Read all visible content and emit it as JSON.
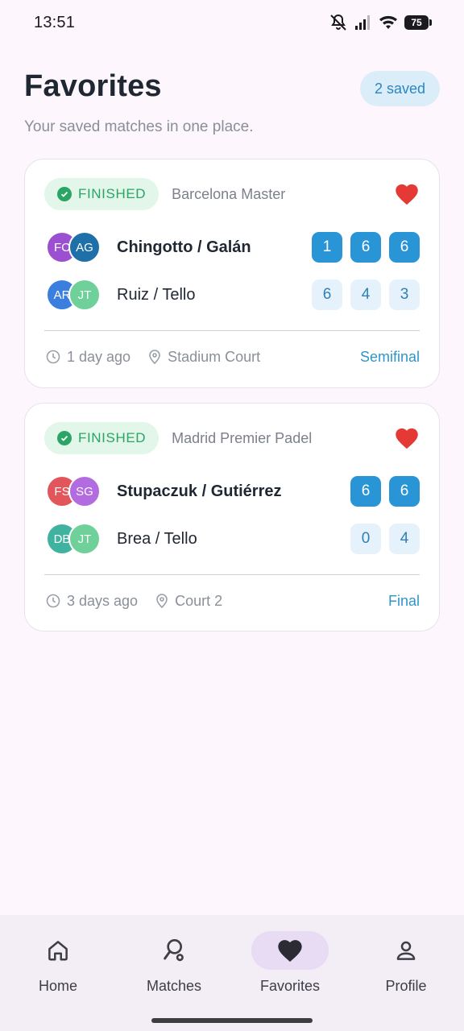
{
  "status_bar": {
    "time": "13:51",
    "battery": "75"
  },
  "header": {
    "title": "Favorites",
    "saved_badge": "2 saved",
    "subtitle": "Your saved matches in one place."
  },
  "matches": [
    {
      "status": "FINISHED",
      "tournament": "Barcelona Master",
      "teams": [
        {
          "name": "Chingotto / Galán",
          "winner": true,
          "avatars": [
            {
              "initials": "FC",
              "color": "#9b4fd1"
            },
            {
              "initials": "AG",
              "color": "#1f6fa8"
            }
          ],
          "scores": [
            "1",
            "6",
            "6"
          ]
        },
        {
          "name": "Ruiz / Tello",
          "winner": false,
          "avatars": [
            {
              "initials": "AR",
              "color": "#3a7fe0"
            },
            {
              "initials": "JT",
              "color": "#6fd199"
            }
          ],
          "scores": [
            "6",
            "4",
            "3"
          ]
        }
      ],
      "time_ago": "1 day ago",
      "court": "Stadium Court",
      "round": "Semifinal"
    },
    {
      "status": "FINISHED",
      "tournament": "Madrid Premier Padel",
      "teams": [
        {
          "name": "Stupaczuk / Gutiérrez",
          "winner": true,
          "avatars": [
            {
              "initials": "FS",
              "color": "#e2555a"
            },
            {
              "initials": "SG",
              "color": "#b36be0"
            }
          ],
          "scores": [
            "6",
            "6"
          ]
        },
        {
          "name": "Brea / Tello",
          "winner": false,
          "avatars": [
            {
              "initials": "DB",
              "color": "#3fb3a0"
            },
            {
              "initials": "JT",
              "color": "#6fd199"
            }
          ],
          "scores": [
            "0",
            "4"
          ]
        }
      ],
      "time_ago": "3 days ago",
      "court": "Court 2",
      "round": "Final"
    }
  ],
  "nav": [
    {
      "label": "Home",
      "icon": "home-icon",
      "active": false
    },
    {
      "label": "Matches",
      "icon": "racket-icon",
      "active": false
    },
    {
      "label": "Favorites",
      "icon": "heart-icon",
      "active": true
    },
    {
      "label": "Profile",
      "icon": "person-icon",
      "active": false
    }
  ],
  "colors": {
    "accent": "#2a95d6",
    "finished": "#2aa565",
    "favorite": "#e53935",
    "background": "#fdf6fc"
  }
}
